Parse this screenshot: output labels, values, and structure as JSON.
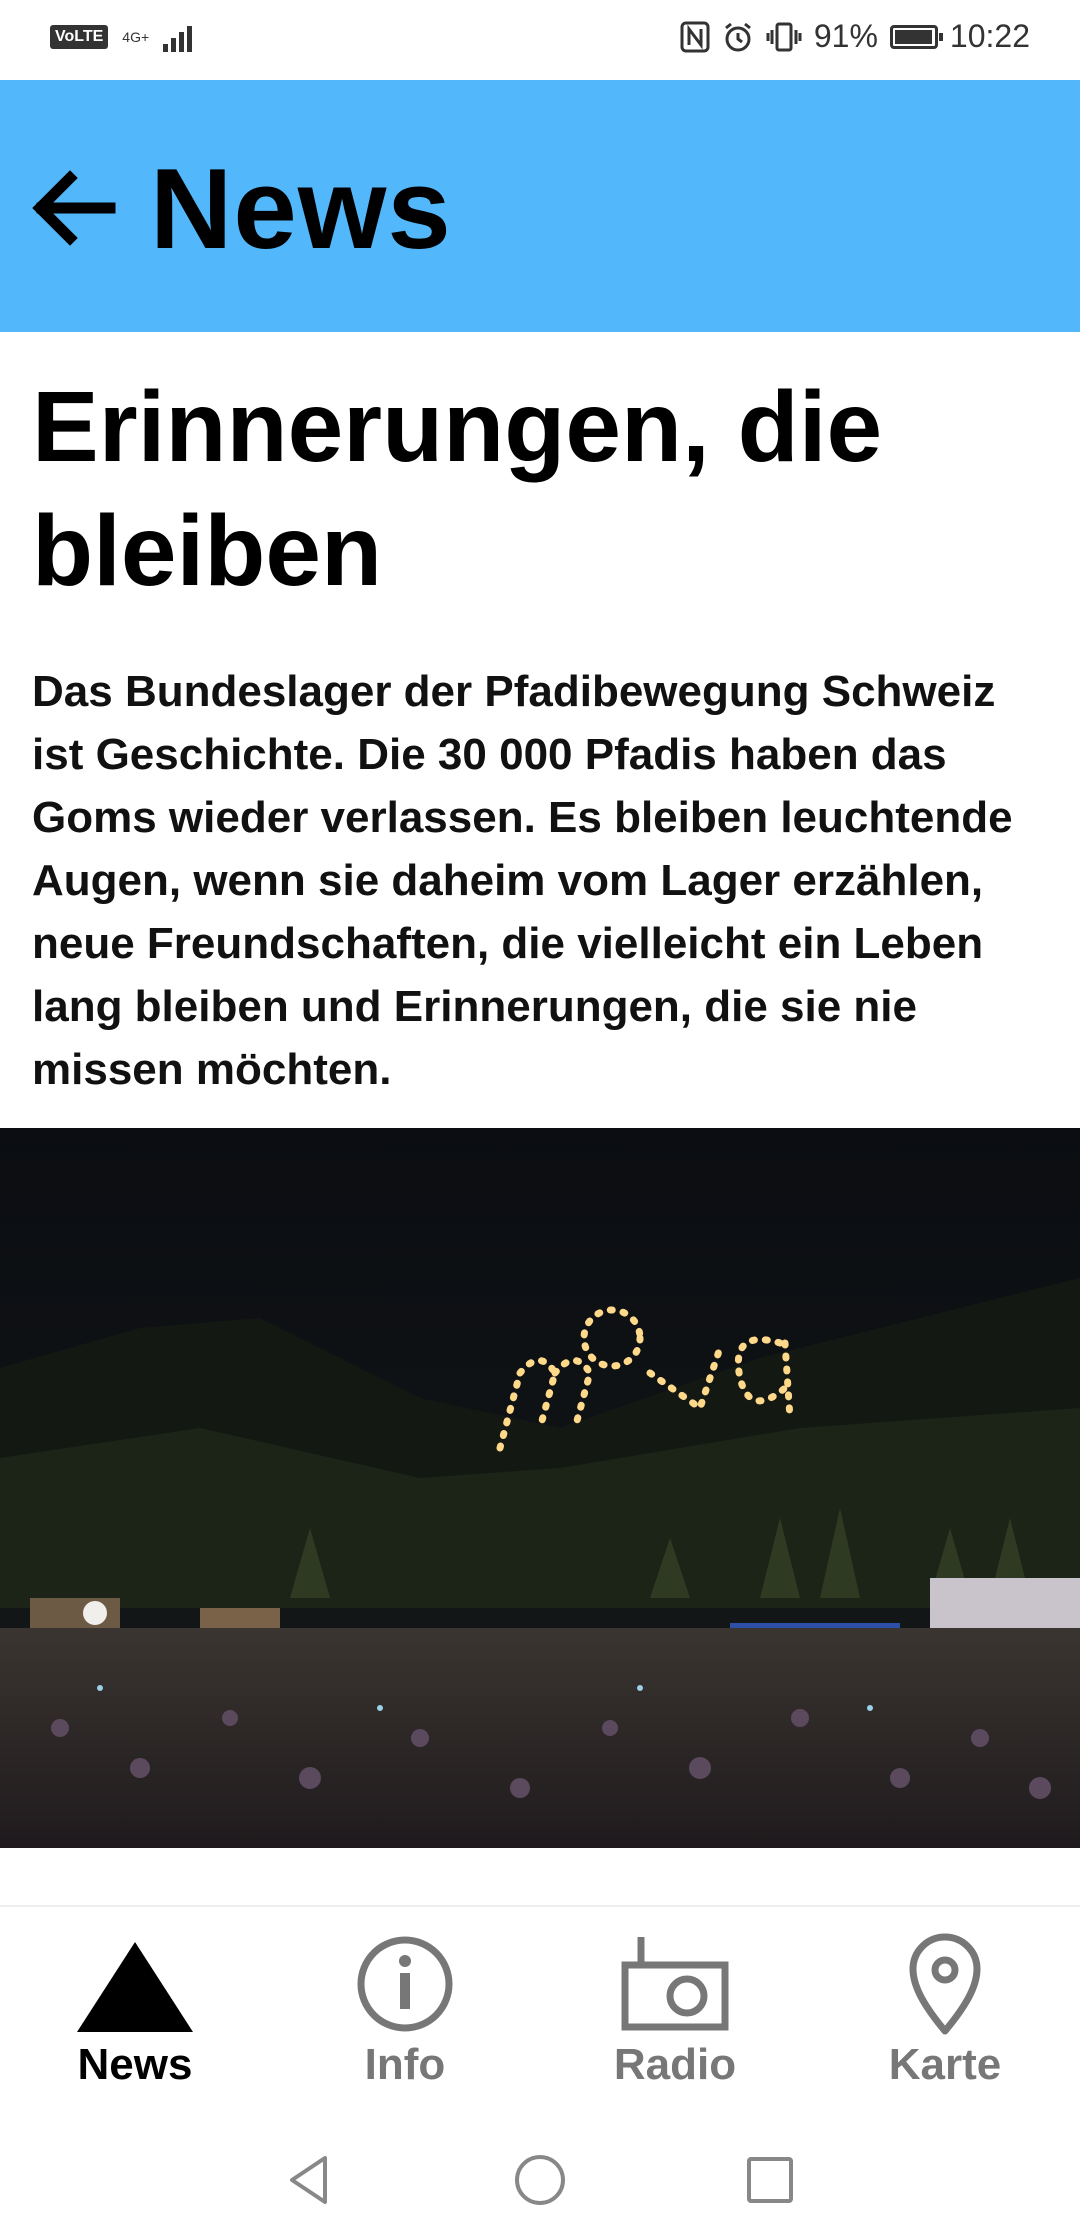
{
  "status_bar": {
    "volte": "VoLTE",
    "network": "4G+",
    "battery": "91%",
    "time": "10:22"
  },
  "header": {
    "title": "News"
  },
  "article": {
    "title": "Erinnerungen, die bleiben",
    "body": "Das Bundeslager der Pfadibewegung Schweiz ist Geschichte. Die 30 000 Pfadis haben das Goms wieder verlassen. Es bleiben leuchtende Augen, wenn sie daheim vom Lager erzählen, neue Freundschaften, die vielleicht ein Leben lang bleiben und Erinnerungen, die sie nie missen möchten.",
    "image_caption_text": "mova"
  },
  "bottom_nav": {
    "items": [
      {
        "label": "News",
        "icon": "tent-icon",
        "active": true
      },
      {
        "label": "Info",
        "icon": "info-icon",
        "active": false
      },
      {
        "label": "Radio",
        "icon": "radio-icon",
        "active": false
      },
      {
        "label": "Karte",
        "icon": "map-pin-icon",
        "active": false
      }
    ]
  },
  "colors": {
    "header_bg": "#53b8fb",
    "active": "#000000",
    "inactive": "#777777"
  }
}
